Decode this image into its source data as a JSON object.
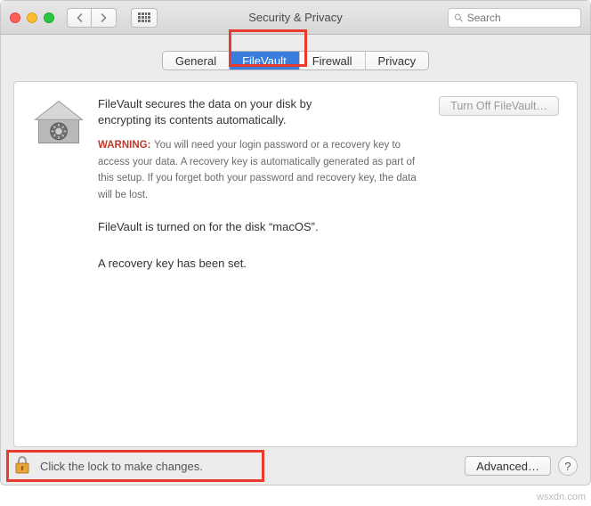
{
  "window": {
    "title": "Security & Privacy"
  },
  "toolbar": {
    "search_placeholder": "Search"
  },
  "tabs": {
    "general": "General",
    "filevault": "FileVault",
    "firewall": "Firewall",
    "privacy": "Privacy"
  },
  "main": {
    "description": "FileVault secures the data on your disk by encrypting its contents automatically.",
    "warning_label": "WARNING:",
    "warning_text": "You will need your login password or a recovery key to access your data. A recovery key is automatically generated as part of this setup. If you forget both your password and recovery key, the data will be lost.",
    "turn_off_label": "Turn Off FileVault…",
    "status_line": "FileVault is turned on for the disk “macOS”.",
    "recovery_line": "A recovery key has been set."
  },
  "footer": {
    "lock_text": "Click the lock to make changes.",
    "advanced_label": "Advanced…",
    "help_label": "?"
  },
  "watermark": "wsxdn.com"
}
